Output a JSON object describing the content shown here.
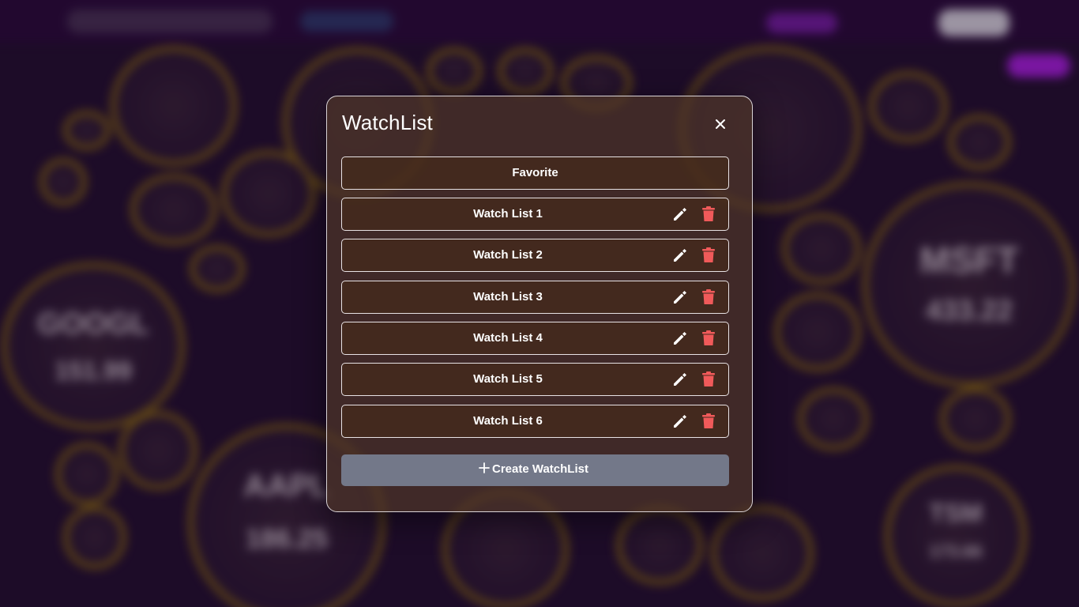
{
  "modal": {
    "title": "WatchList",
    "favorite_label": "Favorite",
    "lists": [
      {
        "label": "Watch List 1"
      },
      {
        "label": "Watch List 2"
      },
      {
        "label": "Watch List 3"
      },
      {
        "label": "Watch List 4"
      },
      {
        "label": "Watch List 5"
      },
      {
        "label": "Watch List 6"
      }
    ],
    "create_label": "Create WatchList"
  },
  "background": {
    "bubbles": [
      {
        "symbol": "GOOGL",
        "value": "151.99"
      },
      {
        "symbol": "MSFT",
        "value": "433.22"
      },
      {
        "symbol": "AAPL",
        "value": "186.25"
      },
      {
        "symbol": "TSM",
        "value": "173.66"
      }
    ]
  },
  "colors": {
    "bubble_ring": "#8a6a12",
    "delete_icon": "#f05a5a",
    "create_button": "#737889",
    "accent_purple": "#b020e8"
  },
  "icons": {
    "close": "close-icon",
    "edit": "pencil-icon",
    "delete": "trash-icon",
    "create": "plus-icon"
  }
}
